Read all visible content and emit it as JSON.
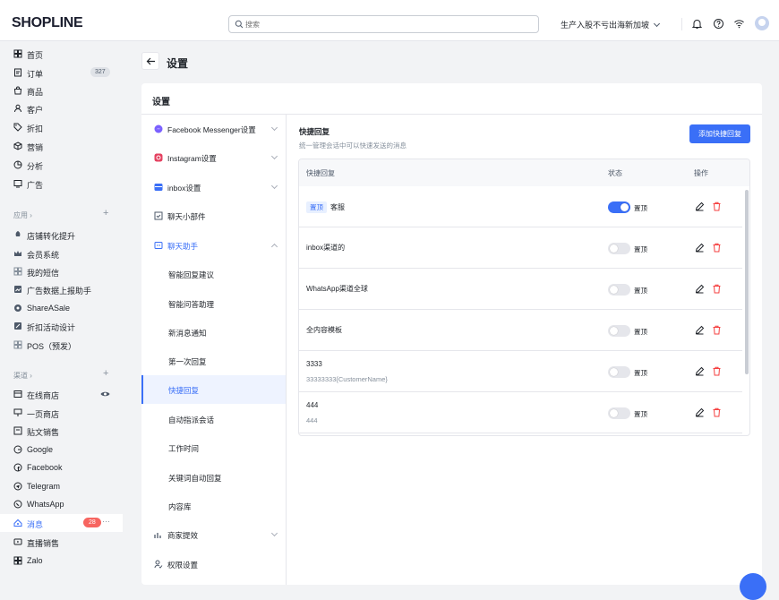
{
  "header": {
    "logo": "SHOPLINE",
    "search_placeholder": "搜索",
    "store_name": "生产入股不亏出海新加坡"
  },
  "sidebar": {
    "main": [
      {
        "label": "首页",
        "icon": "dashboard-icon"
      },
      {
        "label": "订单",
        "icon": "order-icon",
        "badge": "327"
      },
      {
        "label": "商品",
        "icon": "bag-icon"
      },
      {
        "label": "客户",
        "icon": "user-icon"
      },
      {
        "label": "折扣",
        "icon": "tag-icon"
      },
      {
        "label": "营销",
        "icon": "megaphone-icon"
      },
      {
        "label": "分析",
        "icon": "pie-icon"
      },
      {
        "label": "广告",
        "icon": "ad-icon"
      }
    ],
    "apps_title": "应用",
    "apps": [
      {
        "label": "店铺转化提升",
        "icon": "rocket-icon"
      },
      {
        "label": "会员系统",
        "icon": "crown-icon"
      },
      {
        "label": "我的短信",
        "icon": "sms-icon"
      },
      {
        "label": "广告数据上报助手",
        "icon": "report-icon"
      },
      {
        "label": "ShareASale",
        "icon": "share-icon"
      },
      {
        "label": "折扣活动设计",
        "icon": "discount-icon"
      },
      {
        "label": "POS（预发）",
        "icon": "pos-icon"
      }
    ],
    "channels_title": "渠道",
    "channels": [
      {
        "label": "在线商店",
        "icon": "store-icon"
      },
      {
        "label": "一页商店",
        "icon": "page-icon"
      },
      {
        "label": "贴文销售",
        "icon": "post-icon"
      },
      {
        "label": "Google",
        "icon": "google-icon"
      },
      {
        "label": "Facebook",
        "icon": "facebook-icon"
      },
      {
        "label": "Telegram",
        "icon": "telegram-icon"
      },
      {
        "label": "WhatsApp",
        "icon": "whatsapp-icon"
      },
      {
        "label": "消息",
        "icon": "message-icon",
        "badge": "28"
      },
      {
        "label": "直播销售",
        "icon": "live-icon"
      },
      {
        "label": "Zalo",
        "icon": "zalo-icon"
      }
    ]
  },
  "page": {
    "title": "设置",
    "card_title": "设置"
  },
  "submenu": {
    "items": [
      {
        "label": "Facebook Messenger设置"
      },
      {
        "label": "Instagram设置"
      },
      {
        "label": "inbox设置"
      },
      {
        "label": "聊天小部件"
      },
      {
        "label": "聊天助手"
      },
      {
        "label": "智能回复建议"
      },
      {
        "label": "智能问答助理"
      },
      {
        "label": "新消息通知"
      },
      {
        "label": "第一次回复"
      },
      {
        "label": "快捷回复"
      },
      {
        "label": "自动指派会话"
      },
      {
        "label": "工作时间"
      },
      {
        "label": "关键词自动回复"
      },
      {
        "label": "内容库"
      },
      {
        "label": "商家提效"
      },
      {
        "label": "权限设置"
      }
    ]
  },
  "quick_reply": {
    "title": "快捷回复",
    "desc": "统一管理会话中可以快速发送的消息",
    "add_button": "添加快捷回复",
    "columns": [
      "快捷回复",
      "状态",
      "操作"
    ],
    "pinned_tag": "置顶",
    "toggle_label": "置顶",
    "rows": [
      {
        "name": "客服",
        "pinned": true,
        "sub": "",
        "on": true
      },
      {
        "name": "inbox渠道的",
        "pinned": false,
        "sub": "",
        "on": false
      },
      {
        "name": "WhatsApp渠道全球",
        "pinned": false,
        "sub": "",
        "on": false
      },
      {
        "name": "全内容模板",
        "pinned": false,
        "sub": "",
        "on": false
      },
      {
        "name": "3333",
        "pinned": false,
        "sub": "33333333{CustomerName}",
        "on": false
      },
      {
        "name": "444",
        "pinned": false,
        "sub": "444",
        "on": false
      }
    ]
  },
  "colors": {
    "accent": "#3a6ff7",
    "danger": "#f53f3f",
    "badge_red": "#f76560"
  }
}
